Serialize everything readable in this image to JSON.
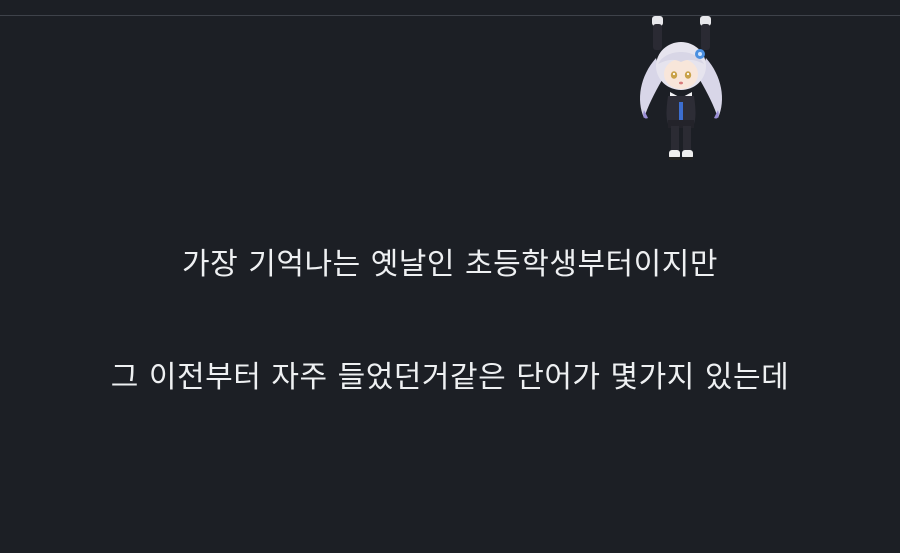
{
  "colors": {
    "background": "#1c1f25",
    "text": "#eef0f2",
    "divider": "#3e424a"
  },
  "sticker": {
    "icon": "chibi-character-sticker"
  },
  "content": {
    "lines": [
      "가장 기억나는 옛날인 초등학생부터이지만",
      "그 이전부터 자주 들었던거같은 단어가 몇가지 있는데"
    ]
  }
}
